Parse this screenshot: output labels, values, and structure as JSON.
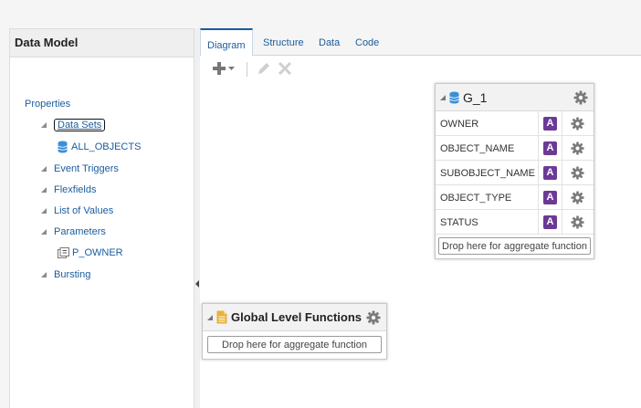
{
  "left_panel": {
    "title": "Data Model",
    "root": "Properties",
    "items": [
      {
        "label": "Data Sets"
      },
      {
        "label": "Event Triggers"
      },
      {
        "label": "Flexfields"
      },
      {
        "label": "List of Values"
      },
      {
        "label": "Parameters"
      },
      {
        "label": "Bursting"
      }
    ],
    "data_set_child": "ALL_OBJECTS",
    "parameter_child": "P_OWNER"
  },
  "tabs": [
    {
      "label": "Diagram"
    },
    {
      "label": "Structure"
    },
    {
      "label": "Data"
    },
    {
      "label": "Code"
    }
  ],
  "group": {
    "title": "G_1",
    "columns": [
      {
        "name": "OWNER",
        "type": "A"
      },
      {
        "name": "OBJECT_NAME",
        "type": "A"
      },
      {
        "name": "SUBOBJECT_NAME",
        "type": "A"
      },
      {
        "name": "OBJECT_TYPE",
        "type": "A"
      },
      {
        "name": "STATUS",
        "type": "A"
      }
    ],
    "drop_text": "Drop here for aggregate function"
  },
  "global_functions": {
    "title": "Global Level Functions",
    "drop_text": "Drop here for aggregate function"
  },
  "colors": {
    "link": "#1a5c9e",
    "type_badge": "#6b3a96",
    "db_icon": "#3a8fd8",
    "doc_icon": "#e8b13a"
  },
  "icons": {
    "add": "plus-icon",
    "edit": "pencil-icon",
    "delete": "close-icon",
    "settings": "gear-icon"
  }
}
